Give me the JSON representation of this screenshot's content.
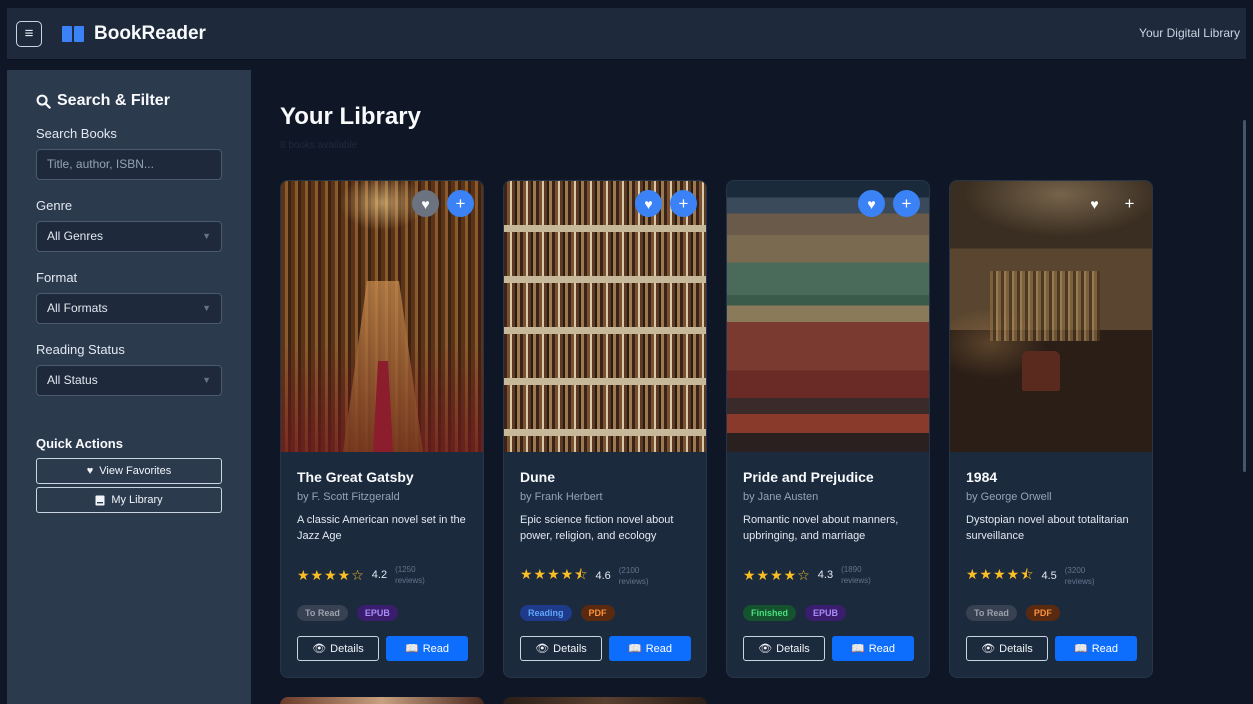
{
  "header": {
    "app_name": "BookReader",
    "tagline": "Your Digital Library"
  },
  "sidebar": {
    "title": "Search & Filter",
    "search_label": "Search Books",
    "search_placeholder": "Title, author, ISBN...",
    "genre_label": "Genre",
    "genre_value": "All Genres",
    "format_label": "Format",
    "format_value": "All Formats",
    "status_label": "Reading Status",
    "status_value": "All Status",
    "quick_actions_title": "Quick Actions",
    "view_favorites_label": "View Favorites",
    "my_library_label": "My Library"
  },
  "main": {
    "title": "Your Library",
    "subtitle": "8 books available"
  },
  "colors": {
    "accent": "#0d6efd",
    "star": "#fbbf24",
    "fav_active": "#3b82f6",
    "fav_inactive": "#6b7280"
  },
  "books": [
    {
      "title": "The Great Gatsby",
      "author": "by F. Scott Fitzgerald",
      "description": "A classic American novel set in the Jazz Age",
      "stars": "★★★★☆",
      "rating": "4.2",
      "reviews": "(1250 reviews)",
      "status": "To Read",
      "format": "EPUB",
      "details_label": "Details",
      "read_label": "Read"
    },
    {
      "title": "Dune",
      "author": "by Frank Herbert",
      "description": "Epic science fiction novel about power, religion, and ecology",
      "stars": "★★★★⯪",
      "rating": "4.6",
      "reviews": "(2100 reviews)",
      "status": "Reading",
      "format": "PDF",
      "details_label": "Details",
      "read_label": "Read"
    },
    {
      "title": "Pride and Prejudice",
      "author": "by Jane Austen",
      "description": "Romantic novel about manners, upbringing, and marriage",
      "stars": "★★★★☆",
      "rating": "4.3",
      "reviews": "(1890 reviews)",
      "status": "Finished",
      "format": "EPUB",
      "details_label": "Details",
      "read_label": "Read"
    },
    {
      "title": "1984",
      "author": "by George Orwell",
      "description": "Dystopian novel about totalitarian surveillance",
      "stars": "★★★★⯪",
      "rating": "4.5",
      "reviews": "(3200 reviews)",
      "status": "To Read",
      "format": "PDF",
      "details_label": "Details",
      "read_label": "Read"
    }
  ]
}
